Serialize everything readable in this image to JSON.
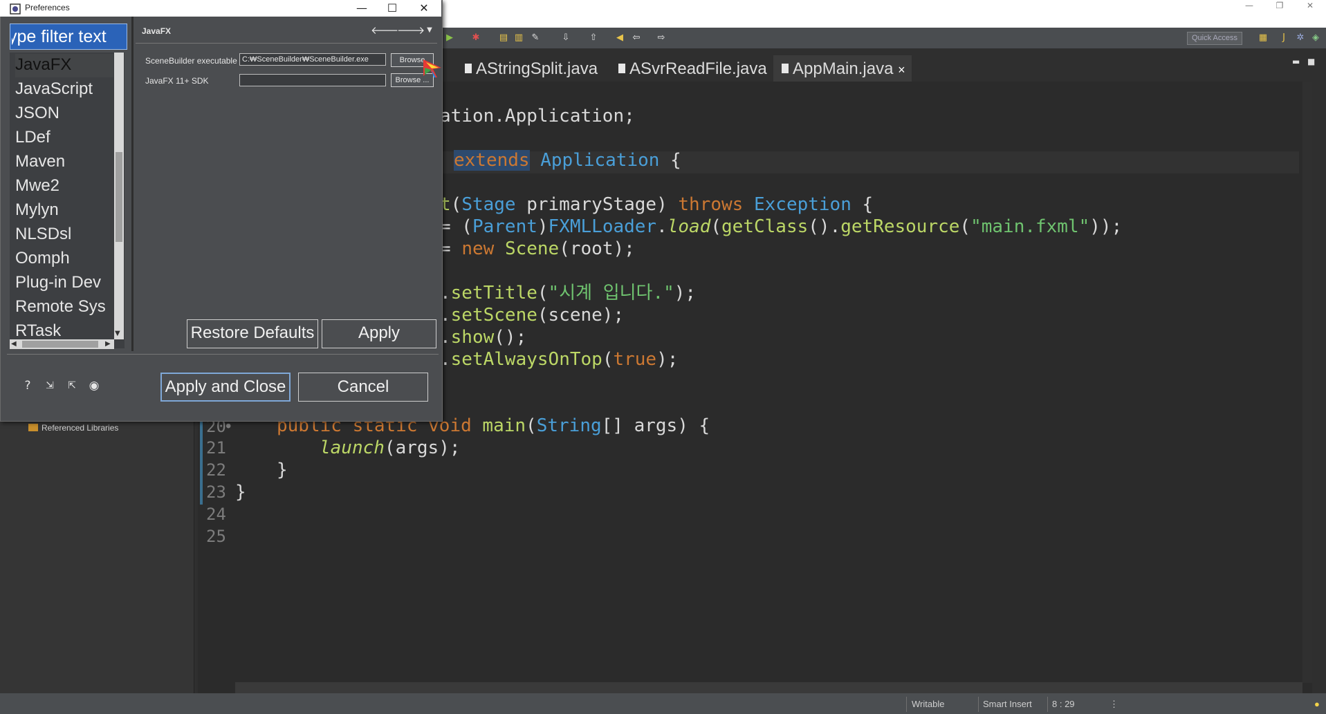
{
  "ide": {
    "quick_access": "Quick Access",
    "tabs": [
      {
        "label": "AStringSplit.java",
        "active": false
      },
      {
        "label": "ASvrReadFile.java",
        "active": false
      },
      {
        "label": "AppMain.java",
        "active": true,
        "close": "×"
      }
    ],
    "explorer_item": "Referenced Libraries",
    "code_lines": [
      {
        "ln": "20",
        "marker": "●"
      },
      {
        "ln": "21"
      },
      {
        "ln": "22"
      },
      {
        "ln": "23"
      },
      {
        "ln": "24"
      },
      {
        "ln": "25"
      }
    ],
    "code": {
      "l1": "ation.Application;",
      "l2_kw": "extends",
      "l2_ty": "Application",
      "l2_end": " {",
      "l3_a": "t",
      "l3_b": "(",
      "l3_ty": "Stage",
      "l3_p": "primaryStage",
      "l3_c": ") ",
      "l3_kw": "throws",
      "l3_ty2": "Exception",
      "l3_d": " {",
      "l4_a": "= (",
      "l4_ty": "Parent",
      "l4_b": ")",
      "l4_ty2": "FXMLLoader",
      "l4_c": ".",
      "l4_fn": "load",
      "l4_d": "(",
      "l4_fn2": "getClass",
      "l4_e": "().",
      "l4_fn3": "getResource",
      "l4_f": "(",
      "l4_st": "\"main.fxml\"",
      "l4_g": "));",
      "l5_a": "= ",
      "l5_kw": "new",
      "l5_b": " ",
      "l5_fn": "Scene",
      "l5_c": "(root);",
      "l6_a": ".",
      "l6_fn": "setTitle",
      "l6_b": "(",
      "l6_st": "\"시계 입니다.\"",
      "l6_c": ");",
      "l7_a": ".",
      "l7_fn": "setScene",
      "l7_b": "(scene);",
      "l8_a": ".",
      "l8_fn": "show",
      "l8_b": "();",
      "l9_a": ".",
      "l9_fn": "setAlwaysOnTop",
      "l9_b": "(",
      "l9_kw": "true",
      "l9_c": ");",
      "m1_kw": "public static void",
      "m1_fn": "main",
      "m1_a": "(",
      "m1_ty": "String",
      "m1_b": "[] ",
      "m1_p": "args",
      "m1_c": ") {",
      "m2_fn": "launch",
      "m2_a": "(",
      "m2_p": "args",
      "m2_b": ");",
      "m3": "}",
      "m4": "}"
    },
    "status": {
      "writable": "Writable",
      "insert_mode": "Smart Insert",
      "position": "8 : 29"
    }
  },
  "dialog": {
    "title": "Preferences",
    "filter_placeholder": "type filter text",
    "tree_items": [
      "JavaFX",
      "JavaScript",
      "JSON",
      "LDef",
      "Maven",
      "Mwe2",
      "Mylyn",
      "NLSDsl",
      "Oomph",
      "Plug-in Dev",
      "Remote Sys",
      "RTask"
    ],
    "selected_item": "JavaFX",
    "page_title": "JavaFX",
    "fields": {
      "scenebuilder_label": "SceneBuilder executable",
      "scenebuilder_value": "C:₩SceneBuilder₩SceneBuilder.exe",
      "sdk_label": "JavaFX 11+ SDK",
      "sdk_value": "",
      "browse_label_1": "Browse",
      "browse_label_2": "Browse ..."
    },
    "buttons": {
      "restore_defaults": "Restore Defaults",
      "apply": "Apply",
      "apply_and_close": "Apply and Close",
      "cancel": "Cancel"
    }
  }
}
